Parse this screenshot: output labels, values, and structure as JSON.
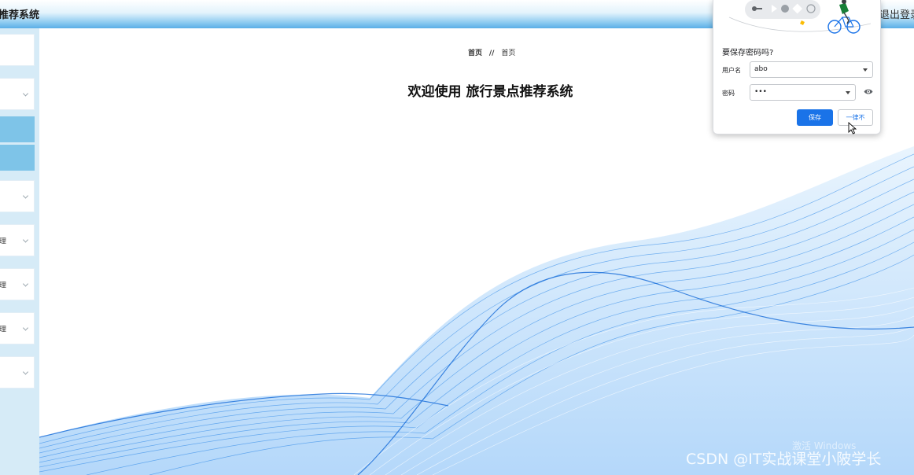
{
  "header": {
    "title": "推荐系统",
    "logout_label": "退出登录"
  },
  "sidebar": {
    "items": [
      {
        "label": "",
        "chevron": false,
        "active": false
      },
      {
        "label": "",
        "chevron": true,
        "active": false
      },
      {
        "label": "",
        "chevron": false,
        "active": true
      },
      {
        "label": "",
        "chevron": false,
        "active": true
      },
      {
        "label": "",
        "chevron": true,
        "active": false
      },
      {
        "label": "理",
        "chevron": true,
        "active": false
      },
      {
        "label": "理",
        "chevron": true,
        "active": false
      },
      {
        "label": "理",
        "chevron": true,
        "active": false
      },
      {
        "label": "",
        "chevron": true,
        "active": false
      }
    ]
  },
  "breadcrumb": {
    "home": "首页",
    "separator": "//",
    "current": "首页"
  },
  "welcome": {
    "text": "欢迎使用 旅行景点推荐系统"
  },
  "password_popup": {
    "title": "要保存密码吗?",
    "username_label": "用户名",
    "username_value": "abo",
    "password_label": "密码",
    "password_value": "•••",
    "save_label": "保存",
    "never_label": "一律不"
  },
  "watermark": {
    "activate": "激活 Windows",
    "csdn": "CSDN @IT实战课堂小陂学长"
  },
  "colors": {
    "header_blue": "#5aaee6",
    "sidebar_bg": "#d6ebf7",
    "active_item": "#7ec4e8",
    "wave_blue": "#1e7fe6",
    "popup_button": "#1a73e8"
  }
}
